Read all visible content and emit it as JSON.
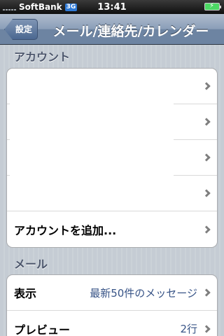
{
  "status_bar": {
    "carrier": "SoftBank",
    "network": "3G",
    "time": "13:41"
  },
  "nav": {
    "back_label": "設定",
    "title": "メール/連絡先/カレンダー"
  },
  "sections": {
    "accounts": {
      "header": "アカウント",
      "add_account_label": "アカウントを追加..."
    },
    "mail": {
      "header": "メール",
      "display_label": "表示",
      "display_value": "最新50件のメッセージ",
      "preview_label": "プレビュー",
      "preview_value": "2行"
    }
  },
  "colors": {
    "nav_tint": "#6d84a2",
    "value_text": "#385487",
    "section_header": "#4c566c"
  }
}
